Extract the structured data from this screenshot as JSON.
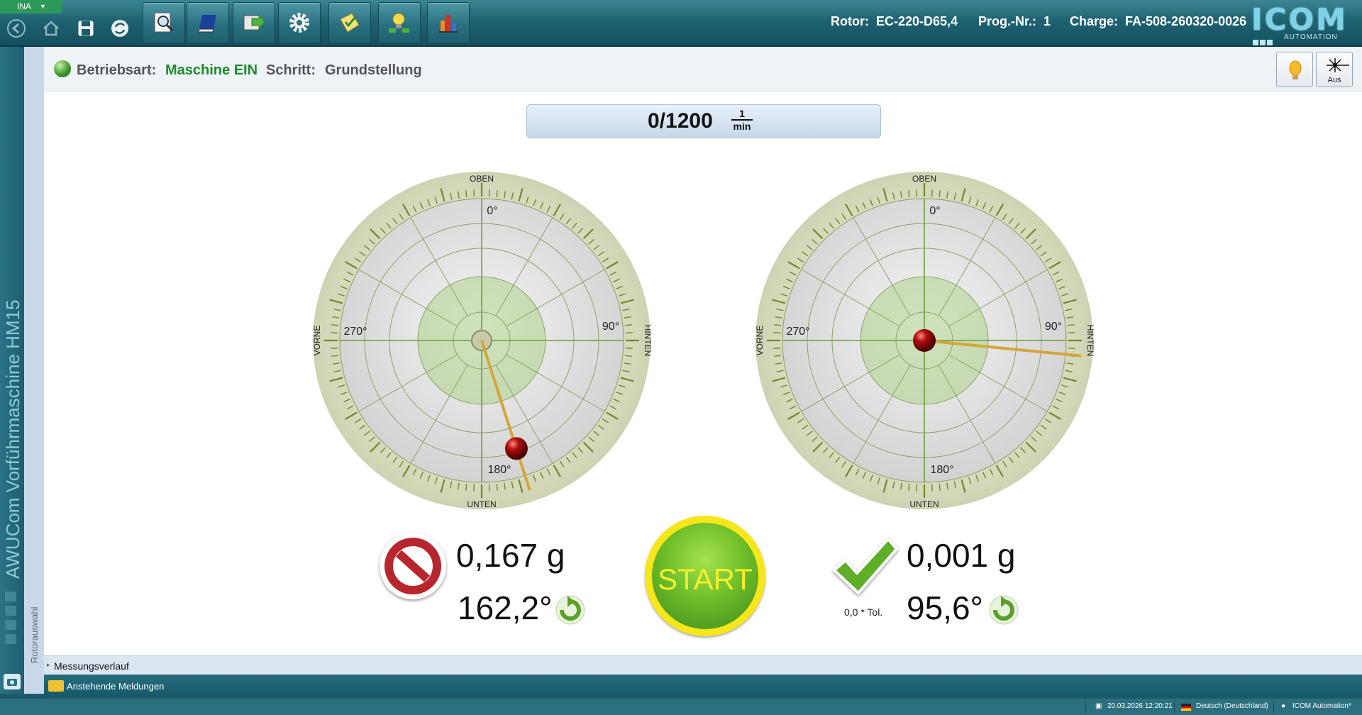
{
  "header": {
    "user_tab": "INA",
    "rotor_label": "Rotor:",
    "rotor_value": "EC-220-D65,4",
    "prog_label": "Prog.-Nr.:",
    "prog_value": "1",
    "charge_label": "Charge:",
    "charge_value": "FA-508-260320-0026",
    "logo_text": "ICOM",
    "logo_sub": "AUTOMATION"
  },
  "toolbar_icons": [
    "back-icon",
    "home-icon",
    "save-icon",
    "sync-icon",
    "search-report-icon",
    "book-icon",
    "export-icon",
    "settings-gear-icon",
    "notes-icon",
    "lightbulb-tools-icon",
    "chart-icon"
  ],
  "sidebar": {
    "title": "AWUCom Vorführmaschine HM15",
    "rotor_tab": "Rotorauswahl"
  },
  "status": {
    "mode_label": "Betriebsart:",
    "mode_value": "Maschine EIN",
    "step_label": "Schritt:",
    "step_value": "Grundstellung",
    "mode_color": "#1f8a2a"
  },
  "corner_buttons": {
    "laser_label": "Aus"
  },
  "speed": {
    "value": "0/1200",
    "unit_num": "1",
    "unit_den": "min"
  },
  "dials": {
    "labels": {
      "top": "OBEN",
      "bottom": "UNTEN",
      "left": "VORNE",
      "right": "HINTEN",
      "deg0": "0°",
      "deg90": "90°",
      "deg180": "180°",
      "deg270": "270°"
    },
    "left": {
      "angle_deg": 162.2,
      "magnitude_fraction": 0.8,
      "status": "fail"
    },
    "right": {
      "angle_deg": 95.6,
      "magnitude_fraction": 0.0,
      "status": "ok"
    }
  },
  "results": {
    "left": {
      "mass": "0,167 g",
      "angle": "162,2°"
    },
    "right": {
      "mass": "0,001 g",
      "angle": "95,6°",
      "tolerance_note": "0,0 * Tol."
    }
  },
  "start_button": {
    "label": "START"
  },
  "bottom": {
    "history_label": "Messungsverlauf",
    "messages_label": "Anstehende Meldungen"
  },
  "taskbar": {
    "datetime": "20.03.2026 12:20:21",
    "language": "Deutsch (Deutschland)",
    "user": "ICOM Automation*"
  },
  "colors": {
    "toolbar": "#1f6272",
    "accent_green": "#6fbe2a",
    "start_ring": "#f7e61a",
    "pointer": "#d4a63a"
  }
}
